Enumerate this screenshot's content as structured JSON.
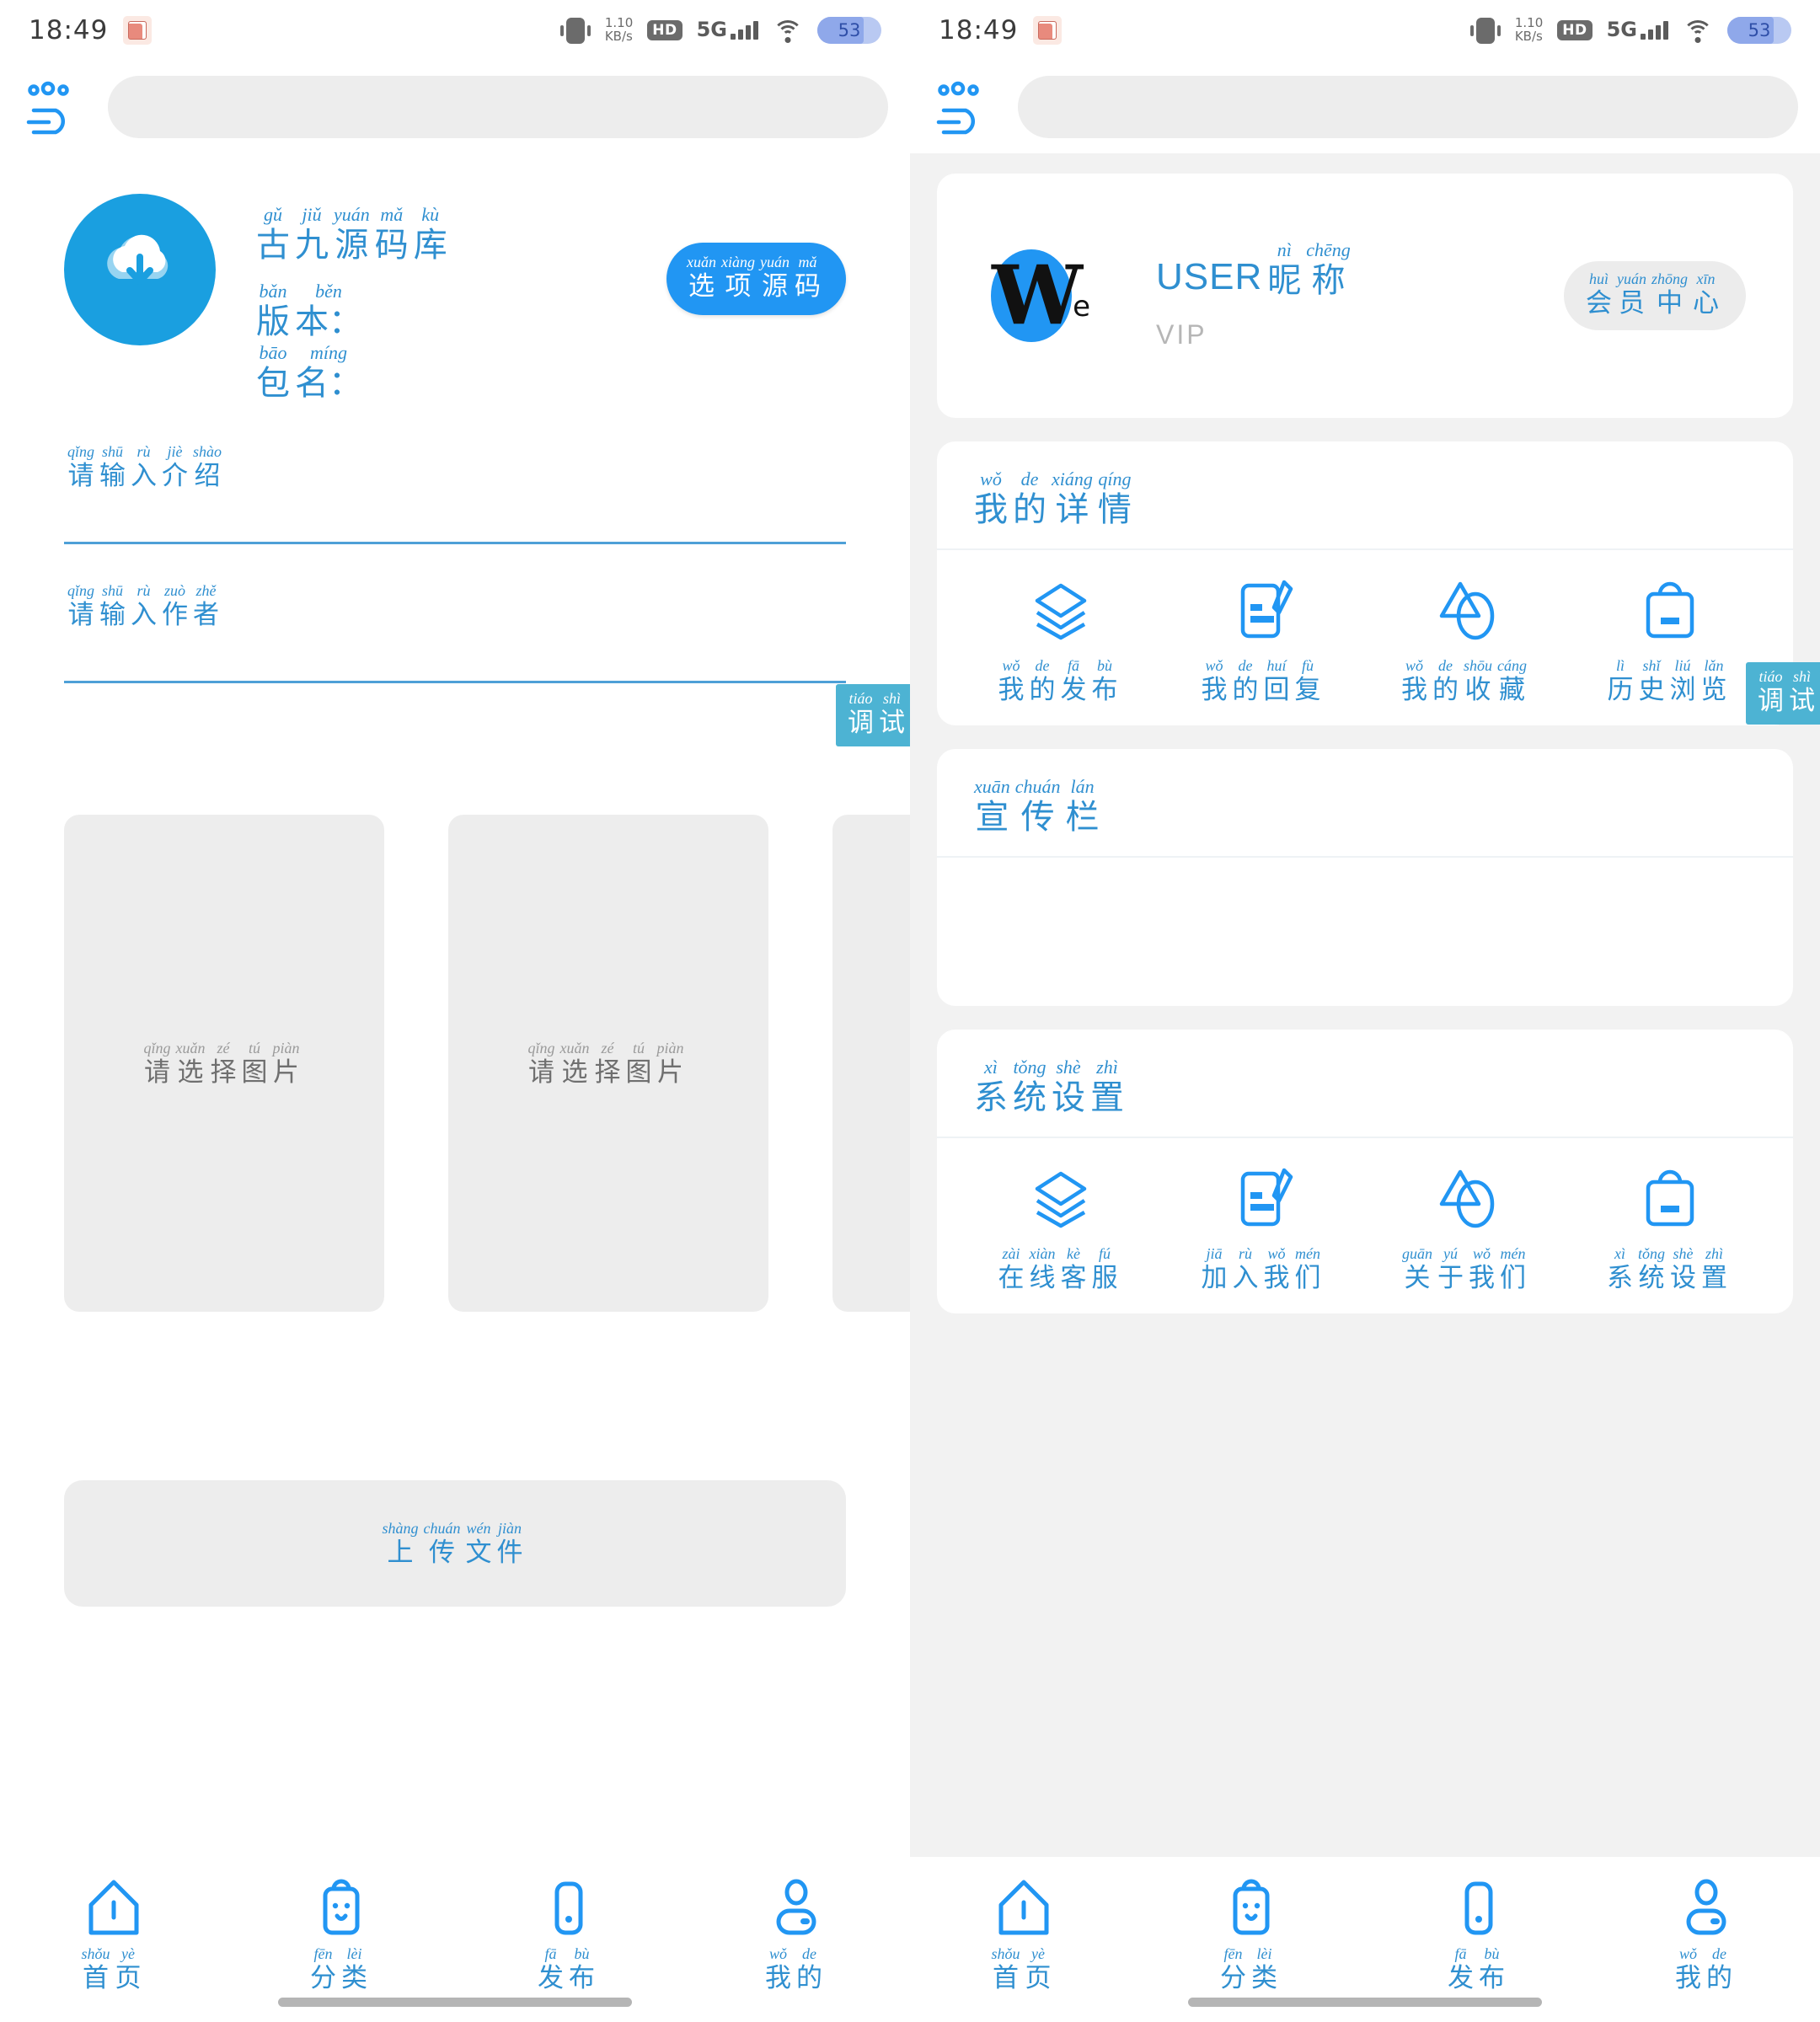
{
  "status_bar": {
    "time": "18:49",
    "app_badge_icon": "cube-app-icon",
    "vibrate_icon": "vibrate-icon",
    "net_speed_value": "1.10",
    "net_speed_unit": "KB/s",
    "hd_label": "HD",
    "network_label": "5G",
    "signal_icon": "signal-bars-icon",
    "wifi_icon": "wifi-icon",
    "battery_level": "53"
  },
  "theme": {
    "primary": "#2196f3",
    "accent_text": "#2f8fd0",
    "debug_badge_bg": "#4db3d3",
    "panel_bg": "#f2f2f2",
    "field_bg": "#ededed"
  },
  "left_screen": {
    "logo_icon": "brand-logo-icon",
    "search_placeholder": "",
    "app_icon": "cloud-download-icon",
    "app_title": [
      {
        "py": "gǔ",
        "hz": "古"
      },
      {
        "py": "jiǔ",
        "hz": "九"
      },
      {
        "py": "yuán",
        "hz": "源"
      },
      {
        "py": "mǎ",
        "hz": "码"
      },
      {
        "py": "kù",
        "hz": "库"
      }
    ],
    "version_label": [
      {
        "py": "bǎn",
        "hz": "版"
      },
      {
        "py": "běn",
        "hz": "本："
      }
    ],
    "package_label": [
      {
        "py": "bāo",
        "hz": "包"
      },
      {
        "py": "míng",
        "hz": "名："
      }
    ],
    "version_value": "",
    "package_value": "",
    "source_button": [
      {
        "py": "xuǎn",
        "hz": "选"
      },
      {
        "py": "xiàng",
        "hz": "项"
      },
      {
        "py": "yuán",
        "hz": "源"
      },
      {
        "py": "mǎ",
        "hz": "码"
      }
    ],
    "intro_field": {
      "label": [
        {
          "py": "qǐng",
          "hz": "请"
        },
        {
          "py": "shū",
          "hz": "输"
        },
        {
          "py": "rù",
          "hz": "入"
        },
        {
          "py": "jiè",
          "hz": "介"
        },
        {
          "py": "shào",
          "hz": "绍"
        }
      ],
      "value": ""
    },
    "author_field": {
      "label": [
        {
          "py": "qǐng",
          "hz": "请"
        },
        {
          "py": "shū",
          "hz": "输"
        },
        {
          "py": "rù",
          "hz": "入"
        },
        {
          "py": "zuò",
          "hz": "作"
        },
        {
          "py": "zhě",
          "hz": "者"
        }
      ],
      "value": ""
    },
    "debug_badge": [
      {
        "py": "tiáo",
        "hz": "调"
      },
      {
        "py": "shì",
        "hz": "试"
      }
    ],
    "image_picker_label": [
      {
        "py": "qǐng",
        "hz": "请"
      },
      {
        "py": "xuǎn",
        "hz": "选"
      },
      {
        "py": "zé",
        "hz": "择"
      },
      {
        "py": "tú",
        "hz": "图"
      },
      {
        "py": "piàn",
        "hz": "片"
      }
    ],
    "image_slots": 3,
    "upload_button": [
      {
        "py": "shàng",
        "hz": "上"
      },
      {
        "py": "chuán",
        "hz": "传"
      },
      {
        "py": "wén",
        "hz": "文"
      },
      {
        "py": "jiàn",
        "hz": "件"
      }
    ]
  },
  "right_screen": {
    "logo_icon": "brand-logo-icon",
    "search_placeholder": "",
    "avatar_icon": "we-avatar-icon",
    "avatar_mark": "W",
    "avatar_sub": "e",
    "user_name_en": "USER",
    "user_name_cn": [
      {
        "py": "nì",
        "hz": "昵"
      },
      {
        "py": "chēng",
        "hz": "称"
      }
    ],
    "vip_label": "VIP",
    "member_button": [
      {
        "py": "huì",
        "hz": "会"
      },
      {
        "py": "yuán",
        "hz": "员"
      },
      {
        "py": "zhōng",
        "hz": "中"
      },
      {
        "py": "xīn",
        "hz": "心"
      }
    ],
    "sections": [
      {
        "title": [
          {
            "py": "wǒ",
            "hz": "我"
          },
          {
            "py": "de",
            "hz": "的"
          },
          {
            "py": "xiáng",
            "hz": "详"
          },
          {
            "py": "qíng",
            "hz": "情"
          }
        ],
        "items": [
          {
            "icon": "layers-icon",
            "label": [
              {
                "py": "wǒ",
                "hz": "我"
              },
              {
                "py": "de",
                "hz": "的"
              },
              {
                "py": "fā",
                "hz": "发"
              },
              {
                "py": "bù",
                "hz": "布"
              }
            ]
          },
          {
            "icon": "edit-document-icon",
            "label": [
              {
                "py": "wǒ",
                "hz": "我"
              },
              {
                "py": "de",
                "hz": "的"
              },
              {
                "py": "huí",
                "hz": "回"
              },
              {
                "py": "fù",
                "hz": "复"
              }
            ]
          },
          {
            "icon": "shapes-icon",
            "label": [
              {
                "py": "wǒ",
                "hz": "我"
              },
              {
                "py": "de",
                "hz": "的"
              },
              {
                "py": "shōu",
                "hz": "收"
              },
              {
                "py": "cáng",
                "hz": "藏"
              }
            ]
          },
          {
            "icon": "shopping-bag-icon",
            "label": [
              {
                "py": "lì",
                "hz": "历"
              },
              {
                "py": "shǐ",
                "hz": "史"
              },
              {
                "py": "liú",
                "hz": "浏"
              },
              {
                "py": "lǎn",
                "hz": "览"
              }
            ]
          }
        ]
      },
      {
        "title": [
          {
            "py": "xuān",
            "hz": "宣"
          },
          {
            "py": "chuán",
            "hz": "传"
          },
          {
            "py": "lán",
            "hz": "栏"
          }
        ],
        "items": []
      },
      {
        "title": [
          {
            "py": "xì",
            "hz": "系"
          },
          {
            "py": "tǒng",
            "hz": "统"
          },
          {
            "py": "shè",
            "hz": "设"
          },
          {
            "py": "zhì",
            "hz": "置"
          }
        ],
        "items": [
          {
            "icon": "layers-icon",
            "label": [
              {
                "py": "zài",
                "hz": "在"
              },
              {
                "py": "xiàn",
                "hz": "线"
              },
              {
                "py": "kè",
                "hz": "客"
              },
              {
                "py": "fú",
                "hz": "服"
              }
            ]
          },
          {
            "icon": "edit-document-icon",
            "label": [
              {
                "py": "jiā",
                "hz": "加"
              },
              {
                "py": "rù",
                "hz": "入"
              },
              {
                "py": "wǒ",
                "hz": "我"
              },
              {
                "py": "mén",
                "hz": "们"
              }
            ]
          },
          {
            "icon": "shapes-icon",
            "label": [
              {
                "py": "guān",
                "hz": "关"
              },
              {
                "py": "yú",
                "hz": "于"
              },
              {
                "py": "wǒ",
                "hz": "我"
              },
              {
                "py": "mén",
                "hz": "们"
              }
            ]
          },
          {
            "icon": "shopping-bag-icon",
            "label": [
              {
                "py": "xì",
                "hz": "系"
              },
              {
                "py": "tǒng",
                "hz": "统"
              },
              {
                "py": "shè",
                "hz": "设"
              },
              {
                "py": "zhì",
                "hz": "置"
              }
            ]
          }
        ]
      }
    ],
    "debug_badge": [
      {
        "py": "tiáo",
        "hz": "调"
      },
      {
        "py": "shì",
        "hz": "试"
      }
    ]
  },
  "tab_bar": {
    "tabs": [
      {
        "icon": "home-icon",
        "label": [
          {
            "py": "shǒu",
            "hz": "首"
          },
          {
            "py": "yè",
            "hz": "页"
          }
        ]
      },
      {
        "icon": "category-icon",
        "label": [
          {
            "py": "fēn",
            "hz": "分"
          },
          {
            "py": "lèi",
            "hz": "类"
          }
        ]
      },
      {
        "icon": "publish-icon",
        "label": [
          {
            "py": "fā",
            "hz": "发"
          },
          {
            "py": "bù",
            "hz": "布"
          }
        ]
      },
      {
        "icon": "profile-icon",
        "label": [
          {
            "py": "wǒ",
            "hz": "我"
          },
          {
            "py": "de",
            "hz": "的"
          }
        ]
      }
    ]
  }
}
